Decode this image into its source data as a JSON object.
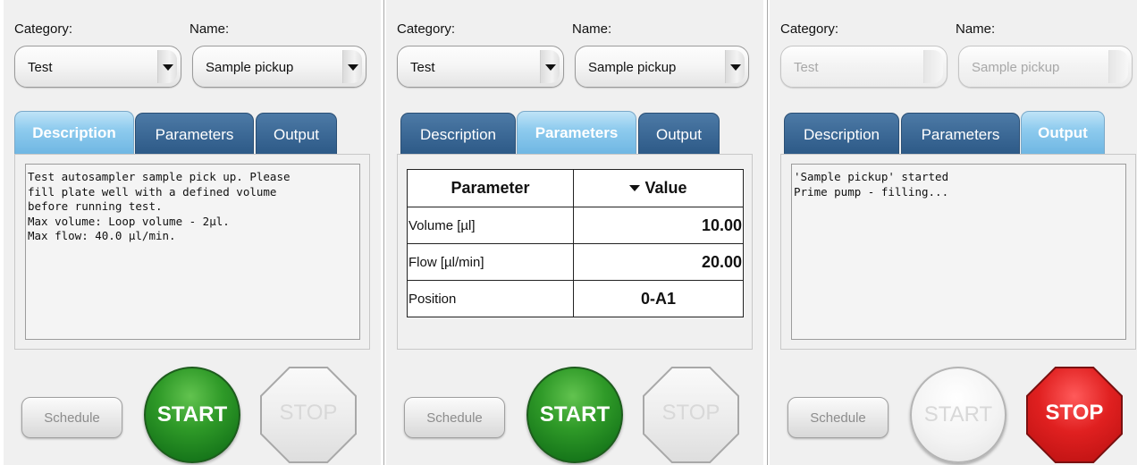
{
  "panels": [
    {
      "category_label": "Category:",
      "name_label": "Name:",
      "category_value": "Test",
      "name_value": "Sample pickup",
      "tabs": [
        "Description",
        "Parameters",
        "Output"
      ],
      "active_tab": "Description",
      "description": "Test autosampler sample pick up. Please\nfill plate well with a defined volume\nbefore running test.\nMax volume: Loop volume - 2µl.\nMax flow: 40.0 µl/min.",
      "schedule_label": "Schedule",
      "start_label": "START",
      "stop_label": "STOP"
    },
    {
      "category_label": "Category:",
      "name_label": "Name:",
      "category_value": "Test",
      "name_value": "Sample pickup",
      "tabs": [
        "Description",
        "Parameters",
        "Output"
      ],
      "active_tab": "Parameters",
      "param_header_name": "Parameter",
      "param_header_value": "Value",
      "parameters": [
        {
          "name": "Volume [µl]",
          "value": "10.00"
        },
        {
          "name": "Flow [µl/min]",
          "value": "20.00"
        },
        {
          "name": "Position",
          "value": "0-A1"
        }
      ],
      "schedule_label": "Schedule",
      "start_label": "START",
      "stop_label": "STOP"
    },
    {
      "category_label": "Category:",
      "name_label": "Name:",
      "category_value": "Test",
      "name_value": "Sample pickup",
      "tabs": [
        "Description",
        "Parameters",
        "Output"
      ],
      "active_tab": "Output",
      "output": "'Sample pickup' started\nPrime pump - filling...",
      "schedule_label": "Schedule",
      "start_label": "START",
      "stop_label": "STOP"
    }
  ],
  "colors": {
    "tab_inactive": "#3e6b98",
    "tab_active": "#8ecbee",
    "start_green": "#2f9a28",
    "stop_red": "#e02020"
  }
}
